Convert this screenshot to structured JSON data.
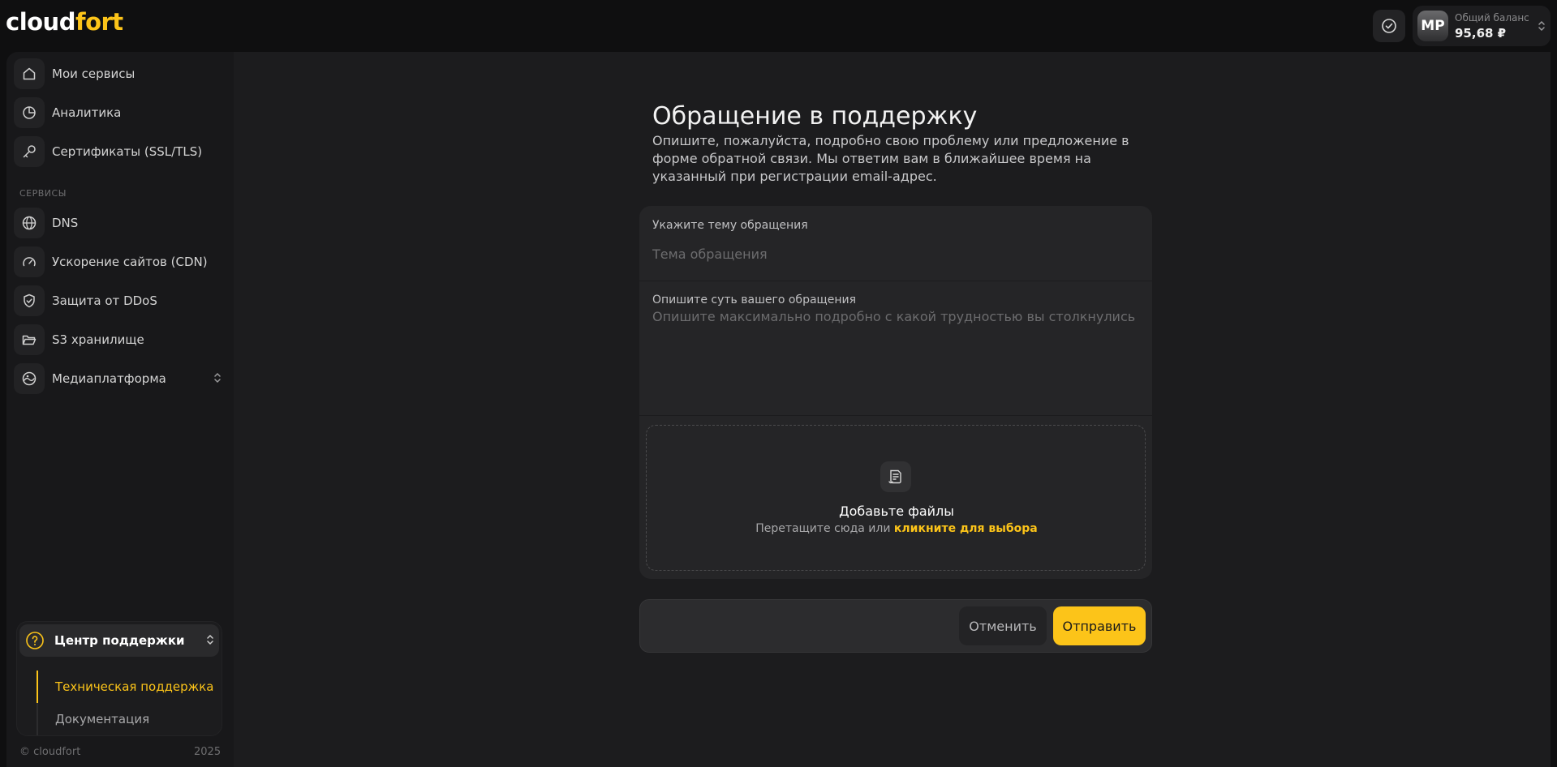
{
  "header": {
    "logo_main": "cloud",
    "logo_accent": "fort",
    "user_initials": "MP",
    "balance_label": "Общий баланс",
    "balance_value": "95,68 ₽",
    "check_icon": "check-circle-icon"
  },
  "sidebar": {
    "items": [
      {
        "label": "Мои сервисы",
        "icon": "home-icon"
      },
      {
        "label": "Аналитика",
        "icon": "pie-chart-icon"
      },
      {
        "label": "Сертификаты (SSL/TLS)",
        "icon": "key-icon"
      }
    ],
    "section_label": "СЕРВИСЫ",
    "services": [
      {
        "label": "DNS",
        "icon": "globe-icon"
      },
      {
        "label": "Ускорение сайтов (CDN)",
        "icon": "speedometer-icon"
      },
      {
        "label": "Защита от DDoS",
        "icon": "shield-icon"
      },
      {
        "label": "S3 хранилище",
        "icon": "folder-icon"
      },
      {
        "label": "Медиаплатформа",
        "icon": "media-icon"
      }
    ],
    "support": {
      "title": "Центр поддержки",
      "items": [
        {
          "label": "Техническая поддержка",
          "active": true
        },
        {
          "label": "Документация",
          "active": false
        }
      ]
    },
    "copyright": "© cloudfort",
    "year": "2025"
  },
  "main": {
    "title": "Обращение в поддержку",
    "description": "Опишите, пожалуйста, подробно свою проблему или предложение в форме обратной связи. Мы ответим вам в ближайшее время на указанный при регистрации email-адрес.",
    "subject_label": "Укажите тему обращения",
    "subject_placeholder": "Тема обращения",
    "subject_value": "",
    "body_label": "Опишите суть вашего обращения",
    "body_placeholder": "Опишите максимально подробно с какой трудностью вы столкнулись",
    "body_value": "",
    "dropzone_title": "Добавьте файлы",
    "dropzone_text": "Перетащите сюда или ",
    "dropzone_link": "кликните для выбора",
    "cancel_label": "Отменить",
    "submit_label": "Отправить"
  },
  "colors": {
    "accent": "#fcc419",
    "background": "#0f0f10",
    "panel": "#1c1c1e"
  }
}
